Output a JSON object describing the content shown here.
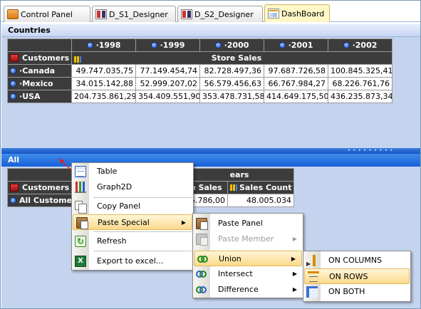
{
  "tabs": [
    {
      "label": "Control Panel",
      "icon": "control-panel-icon"
    },
    {
      "label": "D_S1_Designer",
      "icon": "designer-icon"
    },
    {
      "label": "D_S2_Designer",
      "icon": "designer-icon"
    },
    {
      "label": "DashBoard",
      "icon": "dashboard-icon",
      "active": true
    }
  ],
  "top_panel": {
    "title": "Countries",
    "years": [
      "1998",
      "1999",
      "2000",
      "2001",
      "2002"
    ],
    "row_header": "Customers",
    "measure": "Store Sales",
    "rows": [
      {
        "name": "Canada",
        "values": [
          "49.747.035,75",
          "77.149.454,74",
          "82.728.497,36",
          "97.687.726,58",
          "100.845.325,41"
        ]
      },
      {
        "name": "Mexico",
        "values": [
          "34.015.142,88",
          "52.999.207,02",
          "56.579.456,63",
          "66.767.984,27",
          "68.226.761,76"
        ]
      },
      {
        "name": "USA",
        "values": [
          "204.735.861,29",
          "354.409.551,90",
          "353.478.731,58",
          "414.649.175,50",
          "436.235.873,34"
        ]
      }
    ]
  },
  "bottom_panel": {
    "title": "All",
    "years_header": "ears",
    "row_header": "Customers",
    "col_sales": "e Sales",
    "col_count": "Sales Count",
    "row_label": "All Customers",
    "sales_value": "5.786,00",
    "count_value": "48.005.034"
  },
  "context_menu": {
    "items": [
      {
        "label": "Table",
        "icon": "table-icon"
      },
      {
        "label": "Graph2D",
        "icon": "graph2d-icon"
      },
      {
        "label": "Copy Panel",
        "icon": "copy-icon"
      },
      {
        "label": "Paste Special",
        "icon": "paste-icon",
        "submenu": true
      },
      {
        "label": "Refresh",
        "icon": "refresh-icon"
      },
      {
        "label": "Export to excel...",
        "icon": "excel-icon"
      }
    ]
  },
  "paste_menu": {
    "items": [
      {
        "label": "Paste Panel",
        "icon": "paste-icon"
      },
      {
        "label": "Paste Member",
        "icon": "paste-icon",
        "disabled": true,
        "submenu": true
      },
      {
        "label": "Union",
        "icon": "union-icon",
        "submenu": true
      },
      {
        "label": "Intersect",
        "icon": "intersect-icon",
        "submenu": true
      },
      {
        "label": "Difference",
        "icon": "difference-icon",
        "submenu": true
      }
    ]
  },
  "union_menu": {
    "items": [
      {
        "label": "ON COLUMNS",
        "icon": "columns-icon"
      },
      {
        "label": "ON ROWS",
        "icon": "rows-icon"
      },
      {
        "label": "ON BOTH",
        "icon": "both-icon"
      }
    ]
  },
  "colors": {
    "panel_bg": "#c4d4ef",
    "grid_header": "#3c3c3c",
    "active_bar": "#1760d8",
    "menu_highlight": "#fbd98b"
  }
}
